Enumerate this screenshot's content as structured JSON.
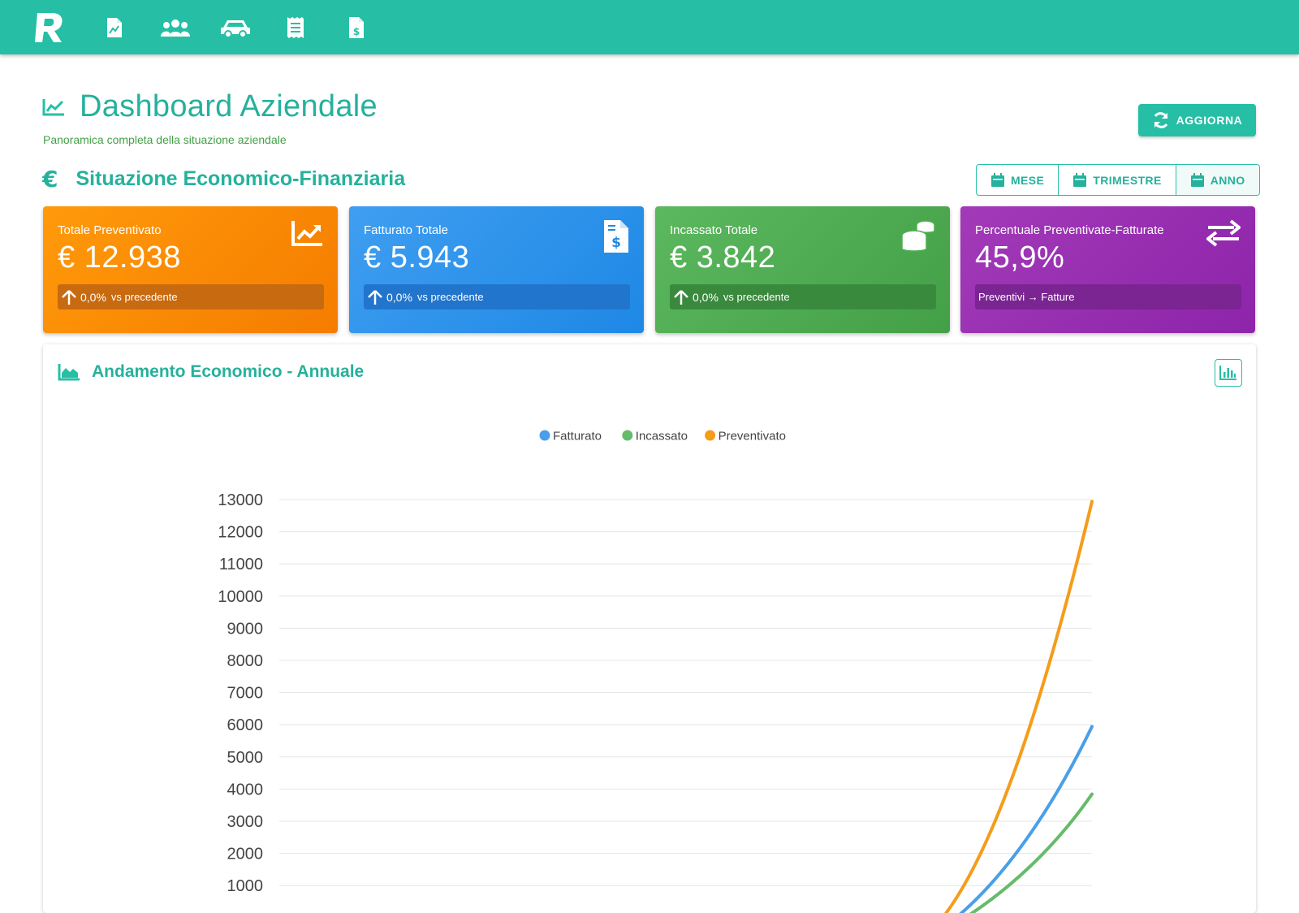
{
  "nav": {
    "logo_letter": "R",
    "items": [
      {
        "icon": "document-chart-icon"
      },
      {
        "icon": "users-icon"
      },
      {
        "icon": "car-icon"
      },
      {
        "icon": "receipt-icon"
      },
      {
        "icon": "invoice-dollar-icon"
      }
    ]
  },
  "header": {
    "title": "Dashboard Aziendale",
    "subtitle": "Panoramica completa della situazione aziendale",
    "refresh_label": "AGGIORNA"
  },
  "section": {
    "title": "Situazione Economico-Finanziaria",
    "periods": [
      {
        "label": "MESE",
        "active": false
      },
      {
        "label": "TRIMESTRE",
        "active": false
      },
      {
        "label": "ANNO",
        "active": true
      }
    ]
  },
  "cards": [
    {
      "label": "Totale Preventivato",
      "value": "€ 12.938",
      "change": "0,0%",
      "change_text": "vs precedente",
      "icon": "chart-line-icon",
      "color": "#fb8c00"
    },
    {
      "label": "Fatturato Totale",
      "value": "€ 5.943",
      "change": "0,0%",
      "change_text": "vs precedente",
      "icon": "invoice-icon",
      "color": "#1e88e5"
    },
    {
      "label": "Incassato Totale",
      "value": "€ 3.842",
      "change": "0,0%",
      "change_text": "vs precedente",
      "icon": "coins-icon",
      "color": "#43a047"
    },
    {
      "label": "Percentuale Preventivate-Fatturate",
      "value": "45,9%",
      "footer": "Preventivi → Fatture",
      "icon": "exchange-arrows-icon",
      "color": "#8e24aa"
    }
  ],
  "chart_panel": {
    "title": "Andamento Economico - Annuale"
  },
  "chart_data": {
    "type": "line",
    "title": "",
    "xlabel": "",
    "ylabel": "",
    "ylim": [
      0,
      13000
    ],
    "yticks": [
      1000,
      2000,
      3000,
      4000,
      5000,
      6000,
      7000,
      8000,
      9000,
      10000,
      11000,
      12000,
      13000
    ],
    "grid": true,
    "legend_position": "top",
    "series": [
      {
        "name": "Fatturato",
        "color": "#4a9fe8",
        "end_value": 5943
      },
      {
        "name": "Incassato",
        "color": "#66bb6a",
        "end_value": 3842
      },
      {
        "name": "Preventivato",
        "color": "#f59c1a",
        "end_value": 12938
      }
    ]
  }
}
